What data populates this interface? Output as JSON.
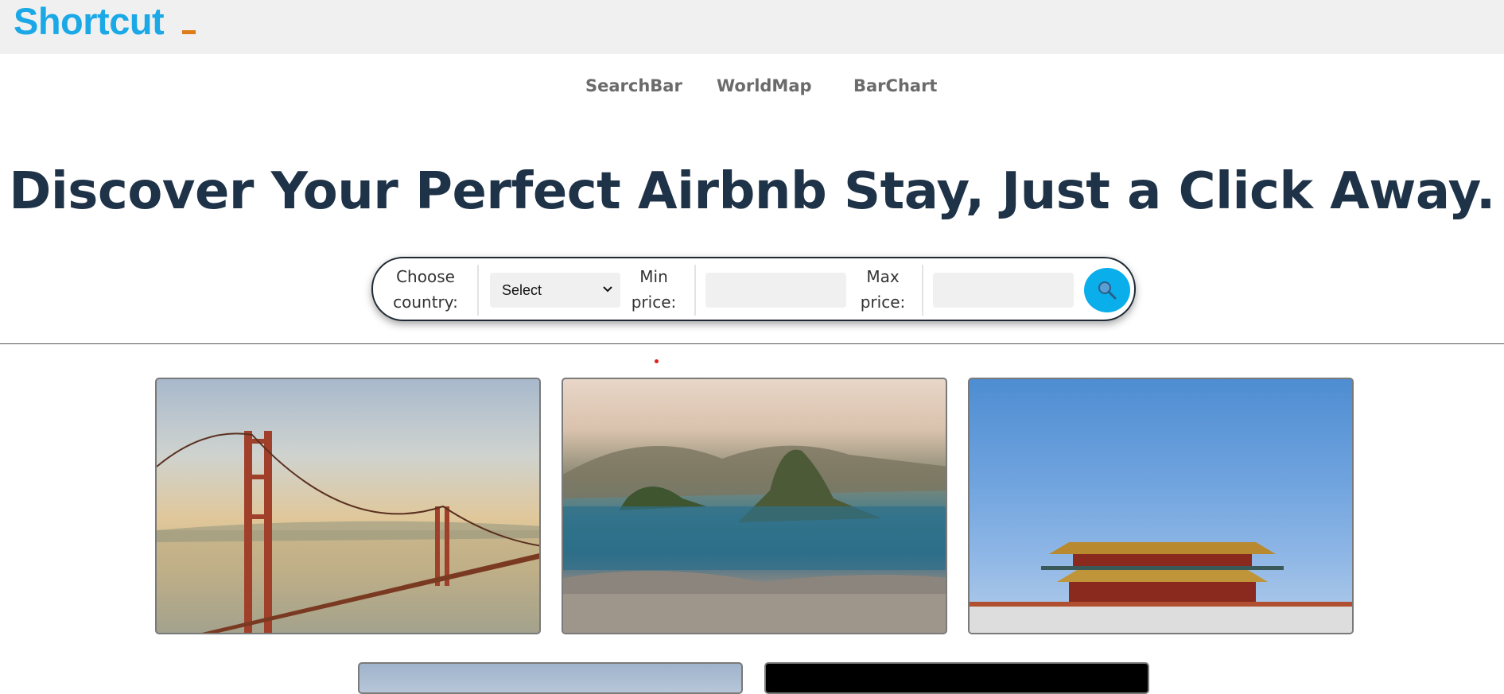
{
  "header": {
    "logo_text": "Shortcut",
    "brand_color": "#1aa9e6",
    "accent_color": "#e07b1a"
  },
  "nav": {
    "items": [
      {
        "label": "SearchBar"
      },
      {
        "label": "WorldMap"
      },
      {
        "label": "BarChart"
      }
    ]
  },
  "hero": {
    "headline": "Discover Your Perfect Airbnb Stay, Just a Click Away."
  },
  "search": {
    "country_label_line1": "Choose",
    "country_label_line2": "country:",
    "country_select_value": "Select",
    "min_label_line1": "Min",
    "min_label_line2": "price:",
    "min_value": "",
    "max_label_line1": "Max",
    "max_label_line2": "price:",
    "max_value": "",
    "search_icon": "search-icon",
    "button_color": "#0aaeea"
  },
  "gallery": {
    "images": [
      {
        "name": "golden-gate-bridge-image"
      },
      {
        "name": "rio-de-janeiro-image"
      },
      {
        "name": "forbidden-city-image"
      },
      {
        "name": "city-image-partial"
      },
      {
        "name": "dark-image-partial"
      }
    ]
  }
}
